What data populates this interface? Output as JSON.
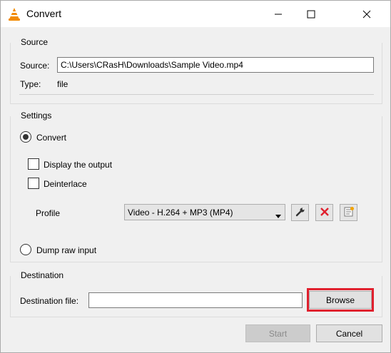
{
  "window": {
    "title": "Convert",
    "minimize_icon": "minimize-icon",
    "maximize_icon": "maximize-icon",
    "close_icon": "close-icon",
    "app_icon": "vlc-cone-icon"
  },
  "source": {
    "group_title": "Source",
    "source_label": "Source:",
    "source_value": "C:\\Users\\CRasH\\Downloads\\Sample Video.mp4",
    "type_label": "Type:",
    "type_value": "file"
  },
  "settings": {
    "group_title": "Settings",
    "convert_label": "Convert",
    "convert_selected": true,
    "display_output_label": "Display the output",
    "display_output_checked": false,
    "deinterlace_label": "Deinterlace",
    "deinterlace_checked": false,
    "profile_label": "Profile",
    "profile_selected": "Video - H.264 + MP3 (MP4)",
    "tool_icons": [
      "wrench-icon",
      "delete-icon",
      "new-profile-icon"
    ],
    "dump_raw_label": "Dump raw input",
    "dump_raw_selected": false
  },
  "destination": {
    "group_title": "Destination",
    "dest_file_label": "Destination file:",
    "dest_file_value": "",
    "browse_label": "Browse"
  },
  "footer": {
    "start_label": "Start",
    "start_enabled": false,
    "cancel_label": "Cancel"
  },
  "colors": {
    "highlight": "#e0202e",
    "vlc_orange": "#f28a00"
  }
}
